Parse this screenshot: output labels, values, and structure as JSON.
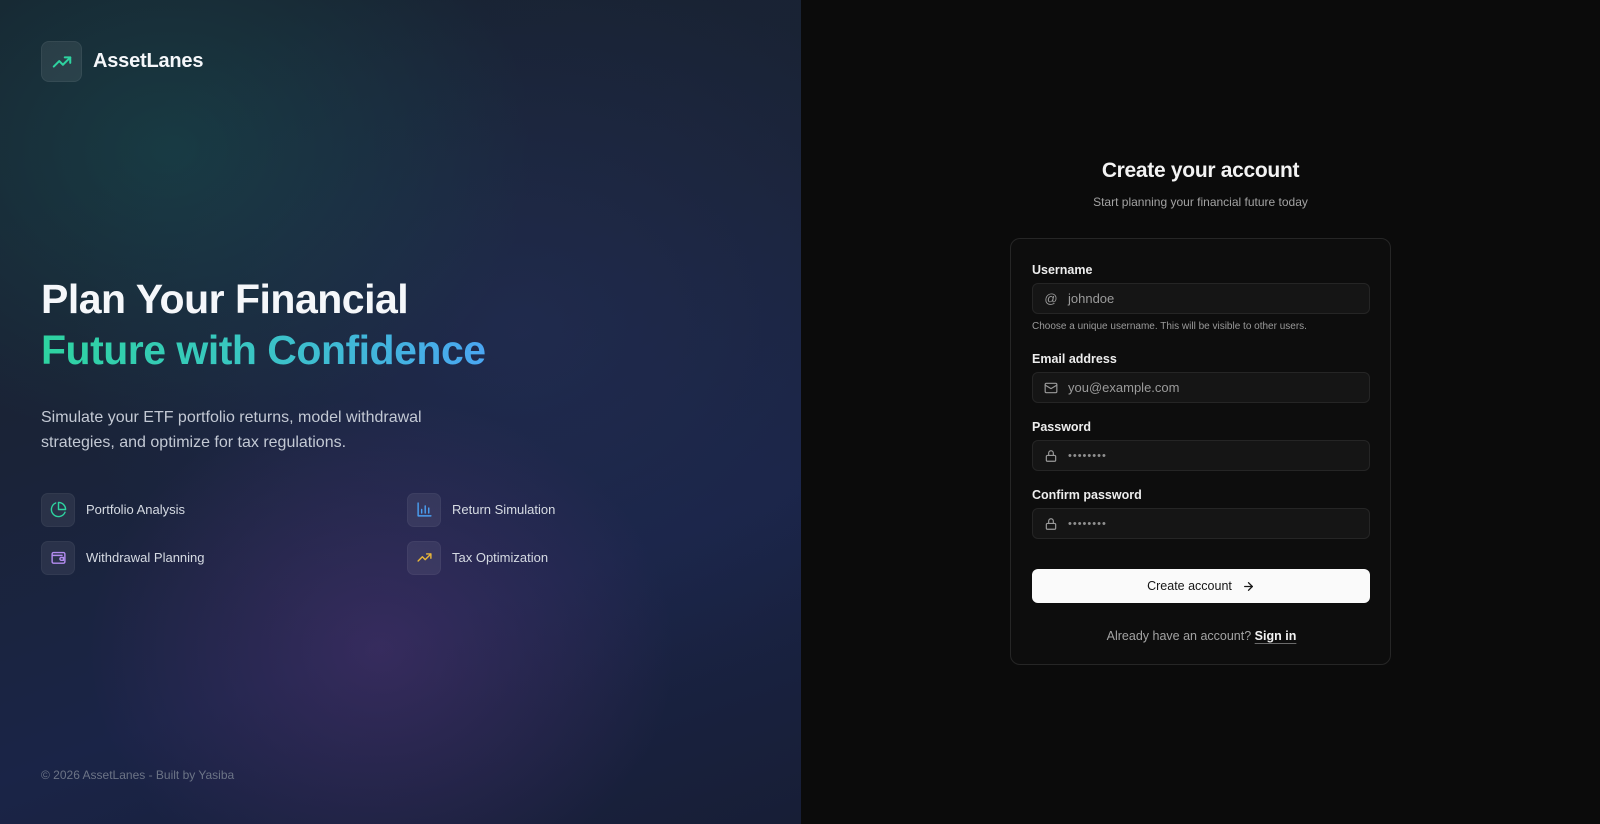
{
  "brand": {
    "name": "AssetLanes",
    "icon": "trending-up-icon",
    "accent": "#2ed3a0"
  },
  "hero": {
    "headline_line1": "Plan Your Financial",
    "headline_line2": "Future with Confidence",
    "lead": "Simulate your ETF portfolio returns, model withdrawal strategies, and optimize for tax regulations.",
    "features": [
      {
        "label": "Portfolio Analysis",
        "icon": "pie-chart-icon",
        "color": "#2ed3a0"
      },
      {
        "label": "Return Simulation",
        "icon": "bar-chart-icon",
        "color": "#4a9ff2"
      },
      {
        "label": "Withdrawal Planning",
        "icon": "wallet-icon",
        "color": "#b38cf0"
      },
      {
        "label": "Tax Optimization",
        "icon": "trending-up-icon",
        "color": "#e8b63a"
      }
    ],
    "footer": "© 2026 AssetLanes - Built by Yasiba"
  },
  "auth": {
    "title": "Create your account",
    "subtitle": "Start planning your financial future today",
    "fields": {
      "username": {
        "label": "Username",
        "placeholder": "johndoe",
        "icon": "at-icon",
        "hint": "Choose a unique username. This will be visible to other users."
      },
      "email": {
        "label": "Email address",
        "placeholder": "you@example.com",
        "icon": "mail-icon"
      },
      "password": {
        "label": "Password",
        "value": "••••••••",
        "icon": "lock-icon"
      },
      "confirm": {
        "label": "Confirm password",
        "value": "••••••••",
        "icon": "lock-icon"
      }
    },
    "submit_label": "Create account",
    "signin_prompt": "Already have an account?",
    "signin_link": "Sign in"
  }
}
